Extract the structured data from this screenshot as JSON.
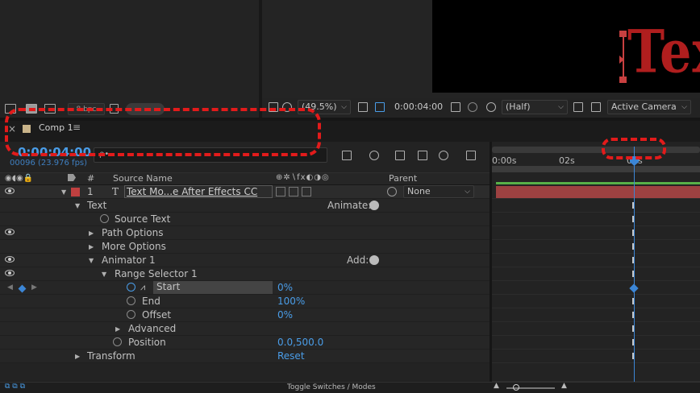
{
  "project": {
    "bpc": "8 bpc",
    "icons": [
      "flowchart-icon",
      "folder-icon",
      "new-comp-icon",
      "trash-icon"
    ]
  },
  "viewer": {
    "comp_text": "Text",
    "zoom": "(49.5%)",
    "timecode": "0:00:04:00",
    "resolution": "(Half)",
    "camera": "Active Camera"
  },
  "timeline": {
    "tab_label": "Comp 1",
    "current_time": "0:00:04:00",
    "frame_info": "00096 (23.976 fps)",
    "search_placeholder": "ρ•",
    "columns": {
      "number": "#",
      "source_name": "Source Name",
      "parent": "Parent"
    },
    "ruler": [
      "0:00s",
      "02s",
      "04s"
    ],
    "layer": {
      "number": "1",
      "type_glyph": "T",
      "name": "Text Mo...e After Effects CC",
      "parent_value": "None"
    },
    "props": {
      "text": "Text",
      "source_text": "Source Text",
      "path_options": "Path Options",
      "more_options": "More Options",
      "animator": "Animator 1",
      "range_selector": "Range Selector 1",
      "start": "Start",
      "start_value": "0%",
      "end": "End",
      "end_value": "100%",
      "offset": "Offset",
      "offset_value": "0%",
      "advanced": "Advanced",
      "position": "Position",
      "position_value": "0.0,500.0",
      "transform": "Transform",
      "transform_reset": "Reset",
      "animate_label": "Animate:",
      "add_label": "Add:"
    },
    "footer_toggle": "Toggle Switches / Modes"
  },
  "colors": {
    "accent_blue": "#4a9de8",
    "layer_red": "#c04a4a",
    "highlight_red": "#e21b1b",
    "comp_text_red": "#b01e1e"
  }
}
